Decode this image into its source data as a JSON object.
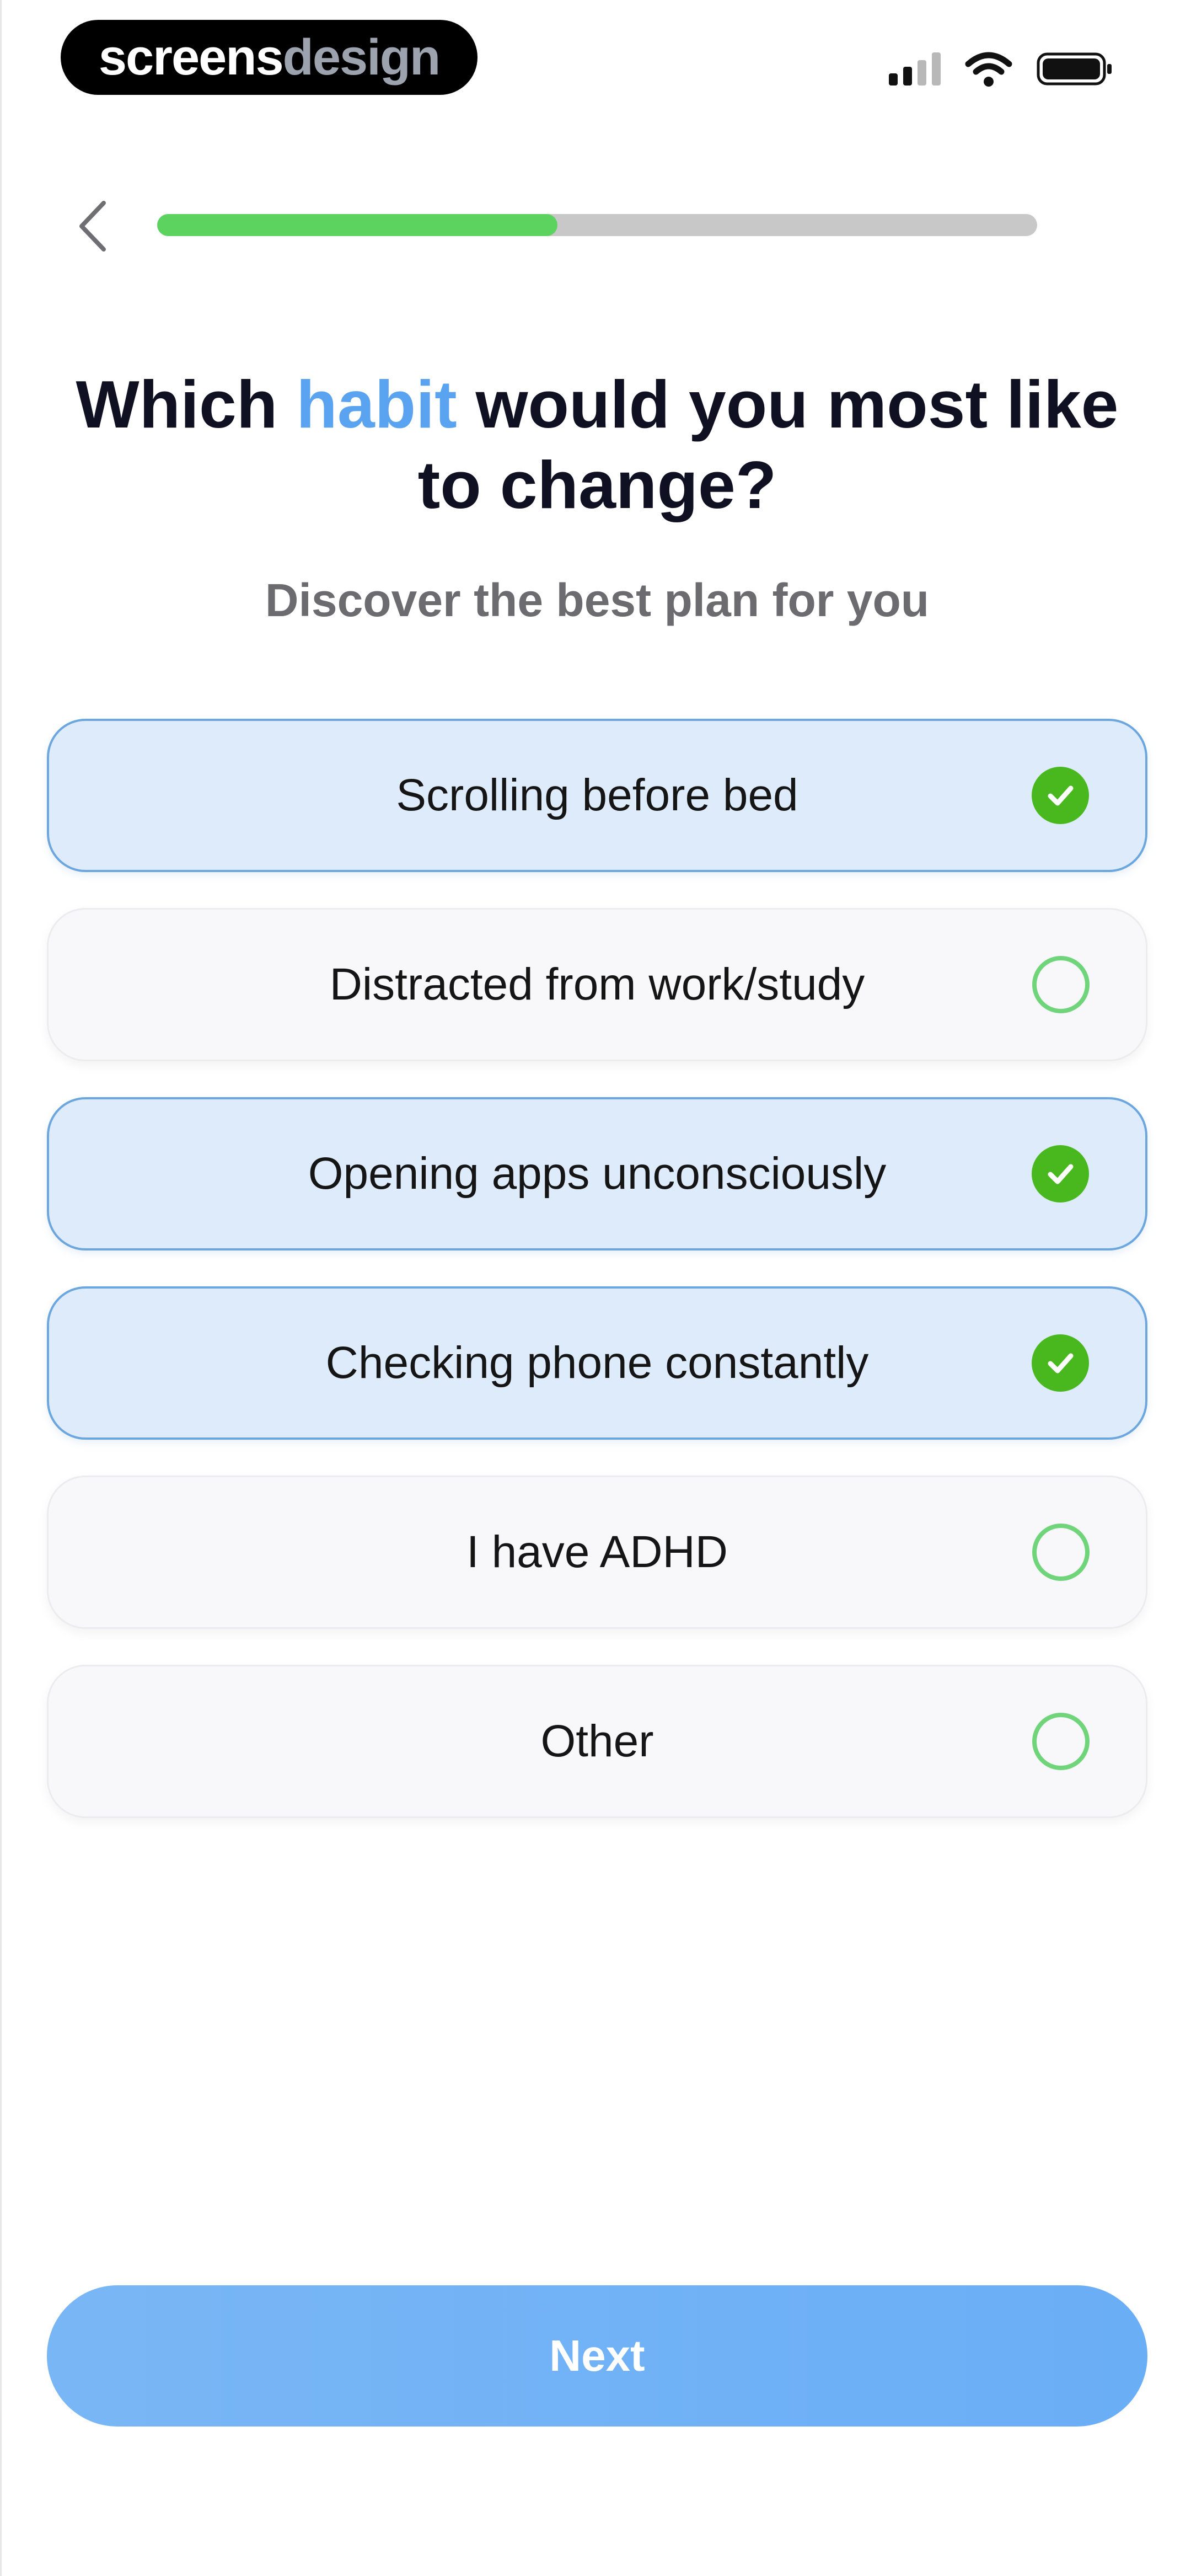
{
  "status_bar": {
    "brand_part1": "screens",
    "brand_part2": "design",
    "icons": [
      "cellular-signal-icon",
      "wifi-icon",
      "battery-icon"
    ]
  },
  "nav": {
    "back_icon": "chevron-left-icon",
    "progress_fraction": 0.455
  },
  "question": {
    "title_before": "Which ",
    "title_accent": "habit",
    "title_after": " would you most like to change?",
    "subtitle": "Discover the best plan for you"
  },
  "options": [
    {
      "label": "Scrolling before bed",
      "selected": true
    },
    {
      "label": "Distracted from work/study",
      "selected": false
    },
    {
      "label": "Opening apps unconsciously",
      "selected": true
    },
    {
      "label": "Checking phone constantly",
      "selected": true
    },
    {
      "label": "I have ADHD",
      "selected": false
    },
    {
      "label": "Other",
      "selected": false
    }
  ],
  "next_button": {
    "label": "Next"
  },
  "colors": {
    "accent_blue": "#5aa3f0",
    "progress_green": "#5dd35f",
    "check_green": "#48b81e",
    "selected_bg": "#ddebfb"
  }
}
